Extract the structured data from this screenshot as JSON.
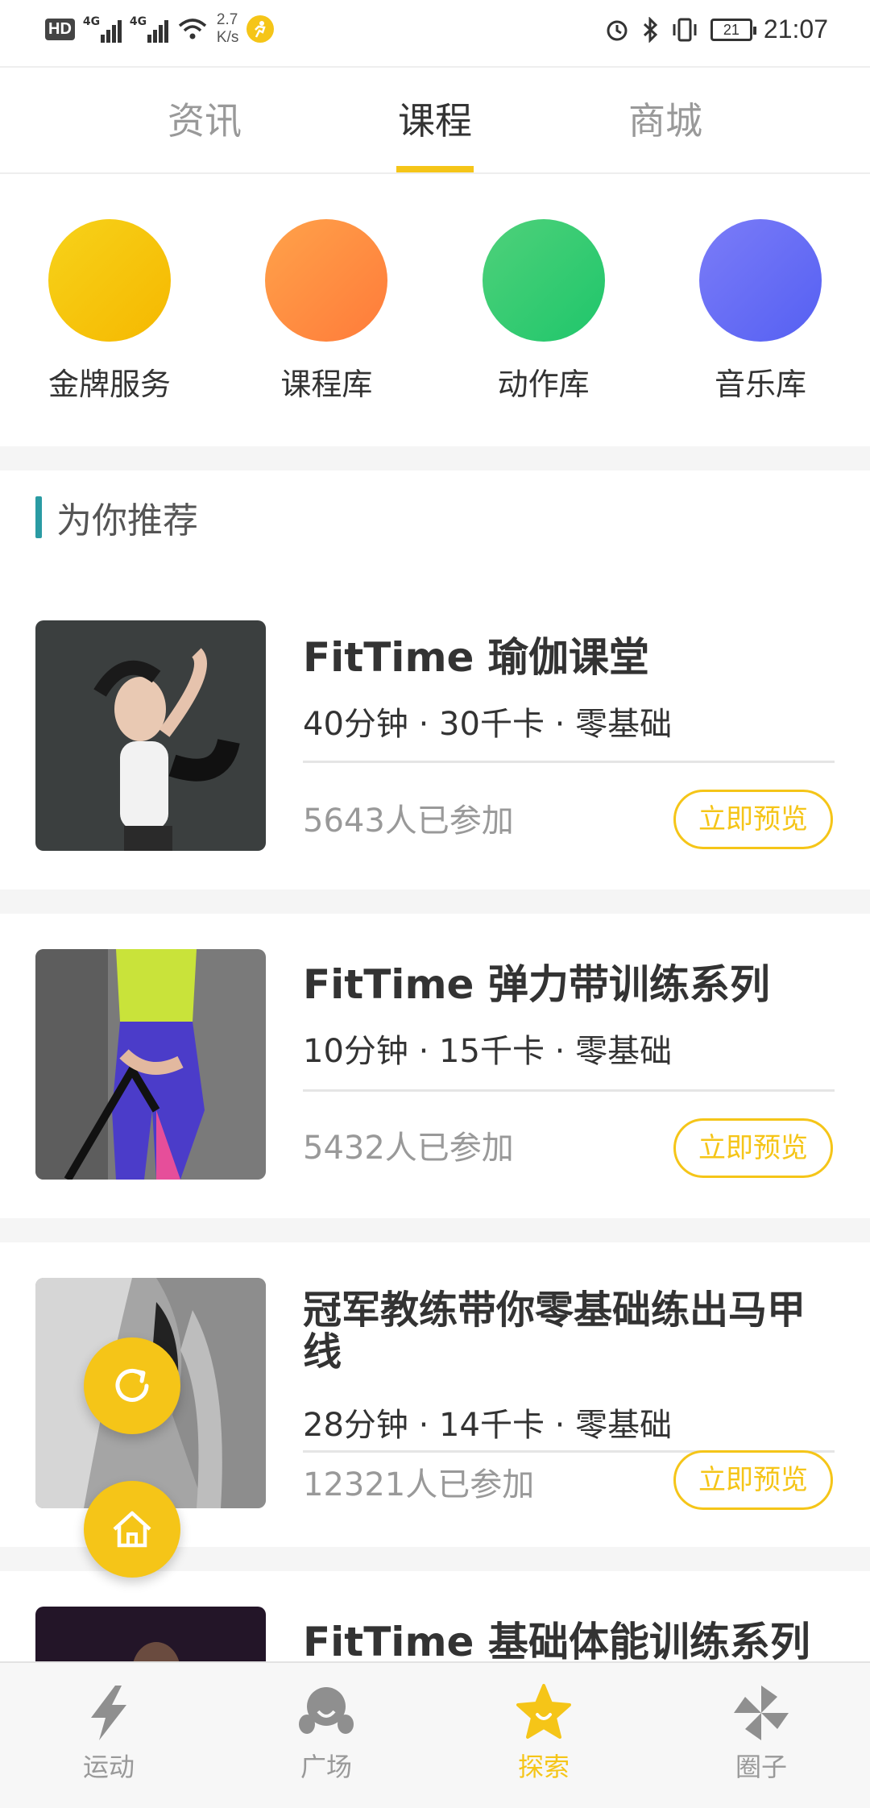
{
  "status_bar": {
    "hd": "HD",
    "net1": "4G",
    "net2": "4G",
    "speed_value": "2.7",
    "speed_unit": "K/s",
    "battery": "21",
    "time": "21:07"
  },
  "top_tabs": [
    {
      "label": "资讯",
      "active": false
    },
    {
      "label": "课程",
      "active": true
    },
    {
      "label": "商城",
      "active": false
    }
  ],
  "categories": [
    {
      "label": "金牌服务",
      "color": "#f5c518"
    },
    {
      "label": "课程库",
      "color": "#ff8c42"
    },
    {
      "label": "动作库",
      "color": "#2ecc71"
    },
    {
      "label": "音乐库",
      "color": "#5b66f5"
    }
  ],
  "section": {
    "title": "为你推荐"
  },
  "courses": [
    {
      "title": "FitTime 瑜伽课堂",
      "meta": "40分钟 · 30千卡 · 零基础",
      "count": "5643人已参加",
      "button": "立即预览"
    },
    {
      "title": "FitTime 弹力带训练系列",
      "meta": "10分钟 · 15千卡 · 零基础",
      "count": "5432人已参加",
      "button": "立即预览"
    },
    {
      "title": "冠军教练带你零基础练出马甲线",
      "meta": "28分钟 · 14千卡 · 零基础",
      "count": "12321人已参加",
      "button": "立即预览"
    },
    {
      "title": "FitTime 基础体能训练系列"
    }
  ],
  "bottom_nav": [
    {
      "label": "运动",
      "icon": "lightning-icon",
      "active": false
    },
    {
      "label": "广场",
      "icon": "plaza-icon",
      "active": false
    },
    {
      "label": "探索",
      "icon": "star-icon",
      "active": true
    },
    {
      "label": "圈子",
      "icon": "pinwheel-icon",
      "active": false
    }
  ],
  "colors": {
    "accent": "#f5c518",
    "section_bar": "#2a9ba3"
  }
}
